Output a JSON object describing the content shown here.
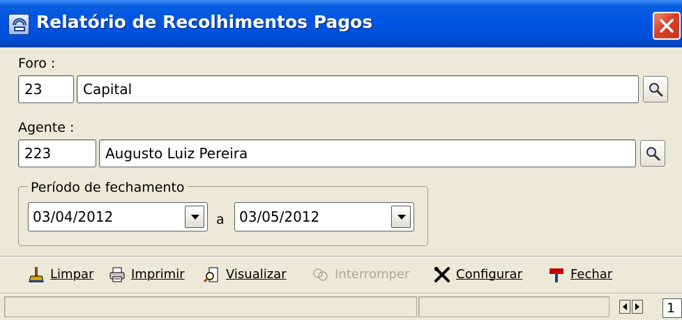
{
  "window": {
    "title": "Relatório de Recolhimentos Pagos",
    "icon": "report-window-icon",
    "close_icon": "close-x-icon"
  },
  "foro": {
    "label": "Foro :",
    "code": "23",
    "name": "Capital",
    "search_icon": "magnifier-icon"
  },
  "agente": {
    "label": "Agente :",
    "code": "223",
    "name": "Augusto Luiz Pereira",
    "search_icon": "magnifier-icon"
  },
  "periodo": {
    "legend": "Período de fechamento",
    "start": "03/04/2012",
    "separator": "a",
    "end": "03/05/2012"
  },
  "toolbar": {
    "items": [
      {
        "label": "Limpar",
        "icon": "broom-icon",
        "enabled": true
      },
      {
        "label": "Imprimir",
        "icon": "printer-icon",
        "enabled": true
      },
      {
        "label": "Visualizar",
        "icon": "magnifier-page-icon",
        "enabled": true
      },
      {
        "label": "Interromper",
        "icon": "stop-icon",
        "enabled": false
      },
      {
        "label": "Configurar",
        "icon": "tools-icon",
        "enabled": true
      },
      {
        "label": "Fechar",
        "icon": "exit-sign-icon",
        "enabled": true
      }
    ]
  },
  "statusbar": {
    "page": "1"
  },
  "colors": {
    "titlebar": "#0054e3",
    "window_bg": "#ece9d8",
    "close_button": "#d8432a"
  }
}
